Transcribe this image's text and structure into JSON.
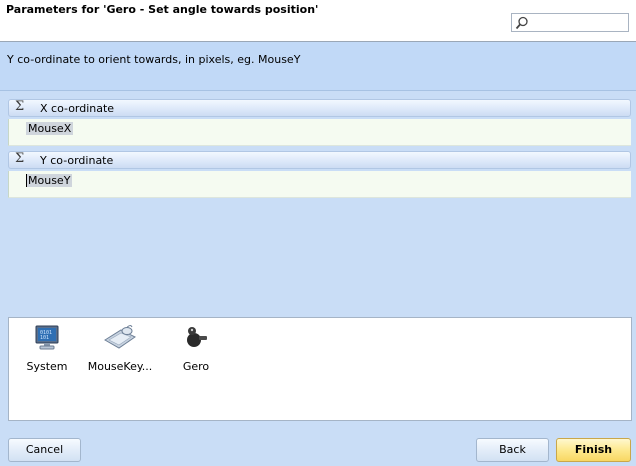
{
  "dialog": {
    "title": "Parameters for 'Gero - Set angle towards position'",
    "search": {
      "value": "",
      "icon": "magnifier-icon"
    }
  },
  "description": "Y co-ordinate to orient towards, in pixels, eg. MouseY",
  "parameters": [
    {
      "label": "X co-ordinate",
      "icon": "sigma-icon",
      "value": "MouseX"
    },
    {
      "label": "Y co-ordinate",
      "icon": "sigma-icon",
      "value": "MouseY"
    }
  ],
  "objects": [
    {
      "label": "System",
      "icon": "system-computer-icon"
    },
    {
      "label": "MouseKey...",
      "icon": "mouse-keyboard-icon"
    },
    {
      "label": "Gero",
      "icon": "gero-sprite-icon"
    }
  ],
  "buttons": {
    "cancel": "Cancel",
    "back": "Back",
    "finish": "Finish"
  },
  "colors": {
    "background": "#c9ddf6",
    "finish_button": "#fde98f",
    "value_field": "#f5fbf1"
  }
}
